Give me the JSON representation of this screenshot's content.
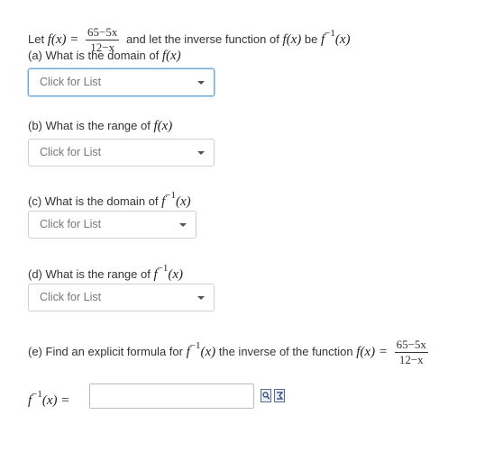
{
  "intro": {
    "text1": "Let",
    "text2": "and let  the inverse function of",
    "text3": "be",
    "fx": "f(x) =",
    "frac_num": "65−5x",
    "frac_den": "12−x",
    "f_of_x": "f(x)",
    "finv": "f",
    "finv_sup": "−1",
    "finv_arg": "(x)"
  },
  "questions": {
    "a": {
      "label": "(a) What is the domain of",
      "math": "f(x)"
    },
    "b": {
      "label": "(b) What is the range of",
      "math": "f(x)"
    },
    "c": {
      "label": "(c) What is the domain of",
      "math_f": "f",
      "math_sup": "−1",
      "math_arg": "(x)"
    },
    "d": {
      "label": "(d) What is the range of",
      "math_f": "f",
      "math_sup": "−1",
      "math_arg": "(x)"
    },
    "e": {
      "label1": "(e) Find an explicit formula for",
      "math_f": "f",
      "math_sup": "−1",
      "math_arg": "(x)",
      "label2": "the inverse of the function",
      "fx": "f(x) =",
      "frac_num": "65−5x",
      "frac_den": "12−x"
    }
  },
  "selects": {
    "a": "Click for List",
    "b": "Click for List",
    "c": "Click for List",
    "d": "Click for List"
  },
  "answer": {
    "label_f": "f",
    "label_sup": "−1",
    "label_arg": "(x) =",
    "value": "",
    "tools": [
      "preview-icon",
      "equation-editor-icon"
    ]
  },
  "colors": {
    "focus_border": "#6ea8d8",
    "text": "#333333",
    "placeholder": "#777777"
  }
}
